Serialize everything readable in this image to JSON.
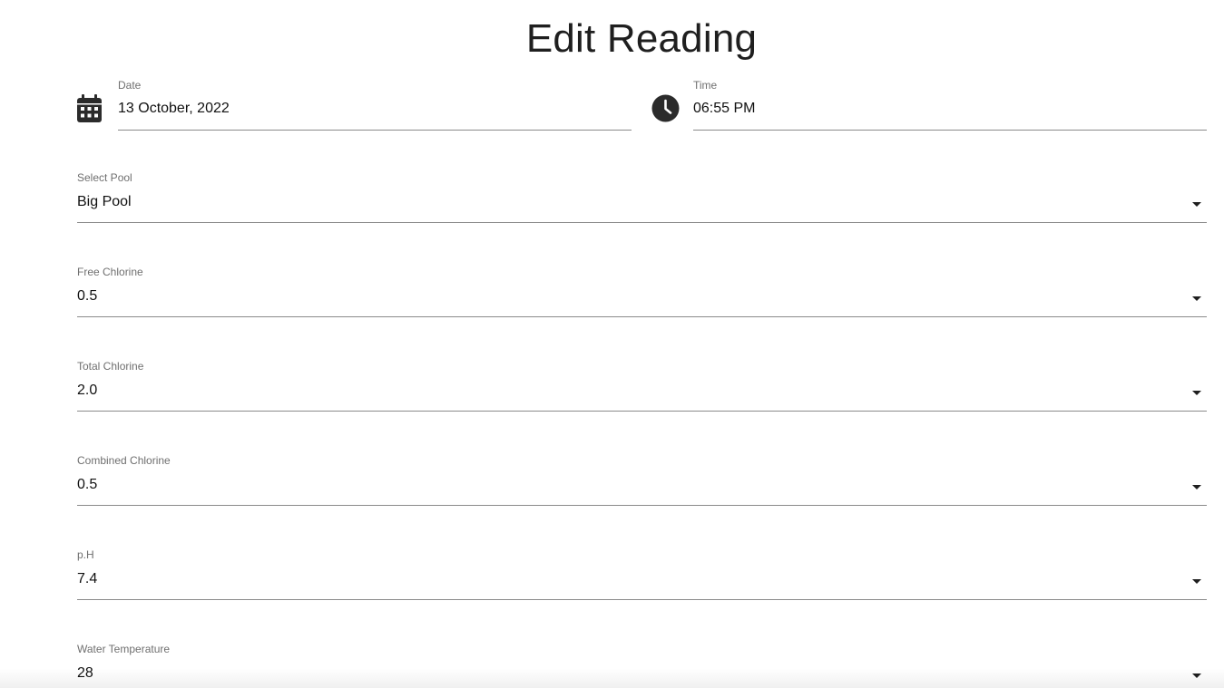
{
  "page": {
    "title": "Edit Reading"
  },
  "date_field": {
    "label": "Date",
    "value": "13 October, 2022",
    "icon": "calendar-icon"
  },
  "time_field": {
    "label": "Time",
    "value": "06:55 PM",
    "icon": "clock-icon"
  },
  "fields": [
    {
      "key": "pool",
      "label": "Select Pool",
      "value": "Big Pool"
    },
    {
      "key": "free_chlorine",
      "label": "Free Chlorine",
      "value": "0.5"
    },
    {
      "key": "total_chlorine",
      "label": "Total Chlorine",
      "value": "2.0"
    },
    {
      "key": "combined_chlorine",
      "label": "Combined Chlorine",
      "value": "0.5"
    },
    {
      "key": "ph",
      "label": "p.H",
      "value": "7.4"
    },
    {
      "key": "water_temperature",
      "label": "Water Temperature",
      "value": "28"
    }
  ],
  "colors": {
    "text": "#1f1f1f",
    "label": "#6f6f6f",
    "underline": "#8a8a8a",
    "icon": "#2b2b2b"
  }
}
